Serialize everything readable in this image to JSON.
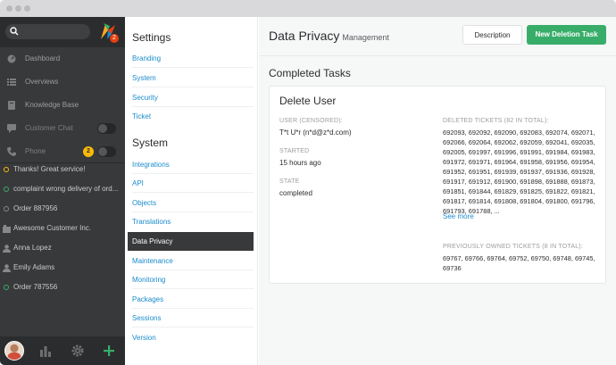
{
  "nav": {
    "badge_count": "2",
    "items": [
      {
        "label": "Dashboard"
      },
      {
        "label": "Overviews"
      },
      {
        "label": "Knowledge Base"
      },
      {
        "label": "Customer Chat"
      },
      {
        "label": "Phone",
        "badge": "2"
      }
    ],
    "tasks": [
      {
        "label": "Thanks! Great service!",
        "status": "yellow"
      },
      {
        "label": "complaint wrong delivery of ord...",
        "status": "green"
      },
      {
        "label": "Order 887956",
        "status": "grey"
      },
      {
        "label": "Awesome Customer Inc.",
        "kind": "organization"
      },
      {
        "label": "Anna Lopez",
        "kind": "user"
      },
      {
        "label": "Emily Adams",
        "kind": "user"
      },
      {
        "label": "Order 787556",
        "status": "green"
      }
    ]
  },
  "settings": {
    "heading_settings": "Settings",
    "settings_links": [
      "Branding",
      "System",
      "Security",
      "Ticket"
    ],
    "heading_system": "System",
    "system_links": [
      "Integrations",
      "API",
      "Objects",
      "Translations",
      "Data Privacy",
      "Maintenance",
      "Monitoring",
      "Packages",
      "Sessions",
      "Version"
    ],
    "active": "Data Privacy"
  },
  "main": {
    "title": "Data Privacy",
    "subtitle": "Management",
    "description_button": "Description",
    "new_button": "New Deletion Task",
    "section_title": "Completed Tasks",
    "card": {
      "title": "Delete User",
      "user_label": "USER (CENSORED):",
      "user_value": "T*t U*r (n*d@z*d.com)",
      "started_label": "STARTED",
      "started_value": "15 hours ago",
      "state_label": "STATE",
      "state_value": "completed",
      "deleted_label": "DELETED TICKETS (82 IN TOTAL):",
      "deleted_lines": [
        "692093, 692092, 692090, 692083, 692074, 692071,",
        "692066, 692064, 692062, 692059, 692041, 692035,",
        "692005, 691997, 691996, 691991, 691984, 691983,",
        "691972, 691971, 691964, 691958, 691956, 691954,",
        "691952, 691951, 691939, 691937, 691936, 691928,",
        "691917, 691912, 691900, 691898, 691888, 691873,",
        "691851, 691844, 691829, 691825, 691822, 691821,",
        "691817, 691814, 691808, 691804, 691800, 691796,",
        "691793, 691788, ..."
      ],
      "see_more": "See more",
      "owned_label": "PREVIOUSLY OWNED TICKETS (8 IN TOTAL):",
      "owned_lines": [
        "69767, 69766, 69764, 69752, 69750, 69748, 69745,",
        "69736"
      ]
    }
  },
  "colors": {
    "accent_green": "#38ad69",
    "link_blue": "#1b8ccc",
    "nav_dark": "#38393b",
    "badge_yellow": "#faba09"
  }
}
